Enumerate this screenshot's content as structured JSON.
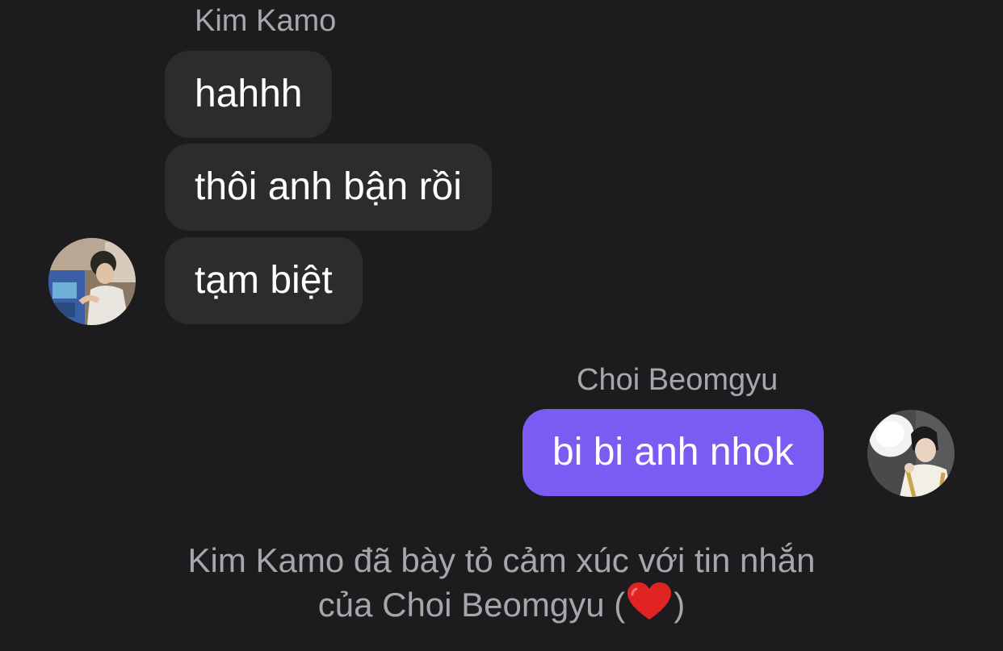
{
  "incoming": {
    "sender_name": "Kim Kamo",
    "avatar_icon": "profile-photo-painting",
    "messages": [
      "hahhh",
      "thôi anh bận rồi",
      "tạm biệt"
    ]
  },
  "outgoing": {
    "sender_name": "Choi Beomgyu",
    "avatar_icon": "profile-photo-hat",
    "messages": [
      "bi bi anh nhok"
    ]
  },
  "reaction_notice": {
    "line1": "Kim Kamo đã bày tỏ cảm xúc với tin nhắn",
    "line2_prefix": "của Choi Beomgyu (",
    "reaction_icon": "heart-icon",
    "line2_suffix": ")"
  },
  "colors": {
    "background": "#1c1c1e",
    "incoming_bubble": "#2c2c2e",
    "outgoing_bubble": "#7a5cf2",
    "secondary_text": "#a6a6ab",
    "heart": "#e02424"
  }
}
